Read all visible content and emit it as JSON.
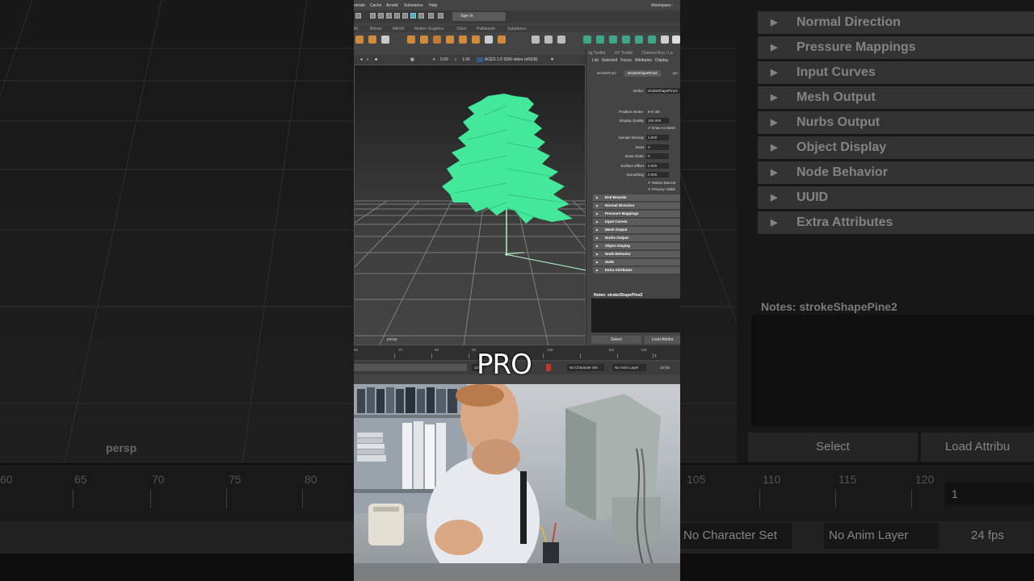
{
  "background": {
    "viewport_label": "persp",
    "sections": [
      "Normal Direction",
      "Pressure Mappings",
      "Input Curves",
      "Mesh Output",
      "Nurbs Output",
      "Object Display",
      "Node Behavior",
      "UUID",
      "Extra Attributes"
    ],
    "notes_title": "Notes:  strokeShapePine2",
    "select_button": "Select",
    "load_button": "Load Attribu",
    "timeline_ticks": [
      "60",
      "65",
      "70",
      "75",
      "80",
      "105",
      "110",
      "115",
      "120"
    ],
    "current_frame": "1",
    "character_set": "No Character Set",
    "anim_layer": "No Anim Layer",
    "fps": "24 fps"
  },
  "maya": {
    "menu": [
      "nerate",
      "Cache",
      "Arnold",
      "Substance",
      "Help"
    ],
    "workspace_label": "Workspace :",
    "sign_in": "Sign In",
    "shelf_tabs": [
      "lld",
      "Bifrost",
      "MASH",
      "Motion Graphics",
      "XGen",
      "Pulldownit",
      "Substance"
    ],
    "viewport_toolbar": {
      "exposure": "0.00",
      "gamma": "1.00",
      "color_space": "ACES 1.0 SDR-video (sRGB)"
    },
    "viewport_label": "persp",
    "attr_tabs": [
      "ng Toolkit",
      "UV Toolkit",
      "Channel Box / La"
    ],
    "attr_menu": [
      "List",
      "Selected",
      "Focus",
      "Attributes",
      "Display"
    ],
    "node_tabs": [
      "strokePine2",
      "strokeShapePine2",
      "pin"
    ],
    "stroke_label": "stroke:",
    "stroke_value": "strokeShapePine2",
    "position_stroke_label": "Position stroke:",
    "position_stroke_value": "In 3D",
    "fields": [
      {
        "label": "Display Quality",
        "value": "100.000"
      },
      {
        "label": "Sample Density",
        "value": "1.000"
      },
      {
        "label": "Seed",
        "value": "0"
      },
      {
        "label": "Draw Order",
        "value": "0"
      },
      {
        "label": "Surface Offset",
        "value": "0.000"
      },
      {
        "label": "Smoothing",
        "value": "0.000"
      }
    ],
    "draw_as_mesh": "Draw As Mesh",
    "motion_blur": "Motion Blurred",
    "primary_visibility": "Primary Visibil",
    "sections": [
      "End Bounds",
      "Normal Direction",
      "Pressure Mappings",
      "Input Curves",
      "Mesh Output",
      "Nurbs Output",
      "Object Display",
      "Node Behavior",
      "UUID",
      "Extra Attributes"
    ],
    "notes_title": "Notes:  strokeShapePine2",
    "select_button": "Select",
    "load_button": "Load Attribu",
    "timeline_ticks": [
      "60",
      "70",
      "80",
      "90",
      "100",
      "110",
      "120"
    ],
    "current_frame": "1",
    "range_end": "120",
    "character_set": "No Character Set",
    "anim_layer": "No Anim Layer",
    "fps": "24 fps"
  },
  "caption": "PRO",
  "colors": {
    "tree_green": "#44e89a",
    "grid_line": "#8f8f8f",
    "panel_bg": "#444444"
  }
}
